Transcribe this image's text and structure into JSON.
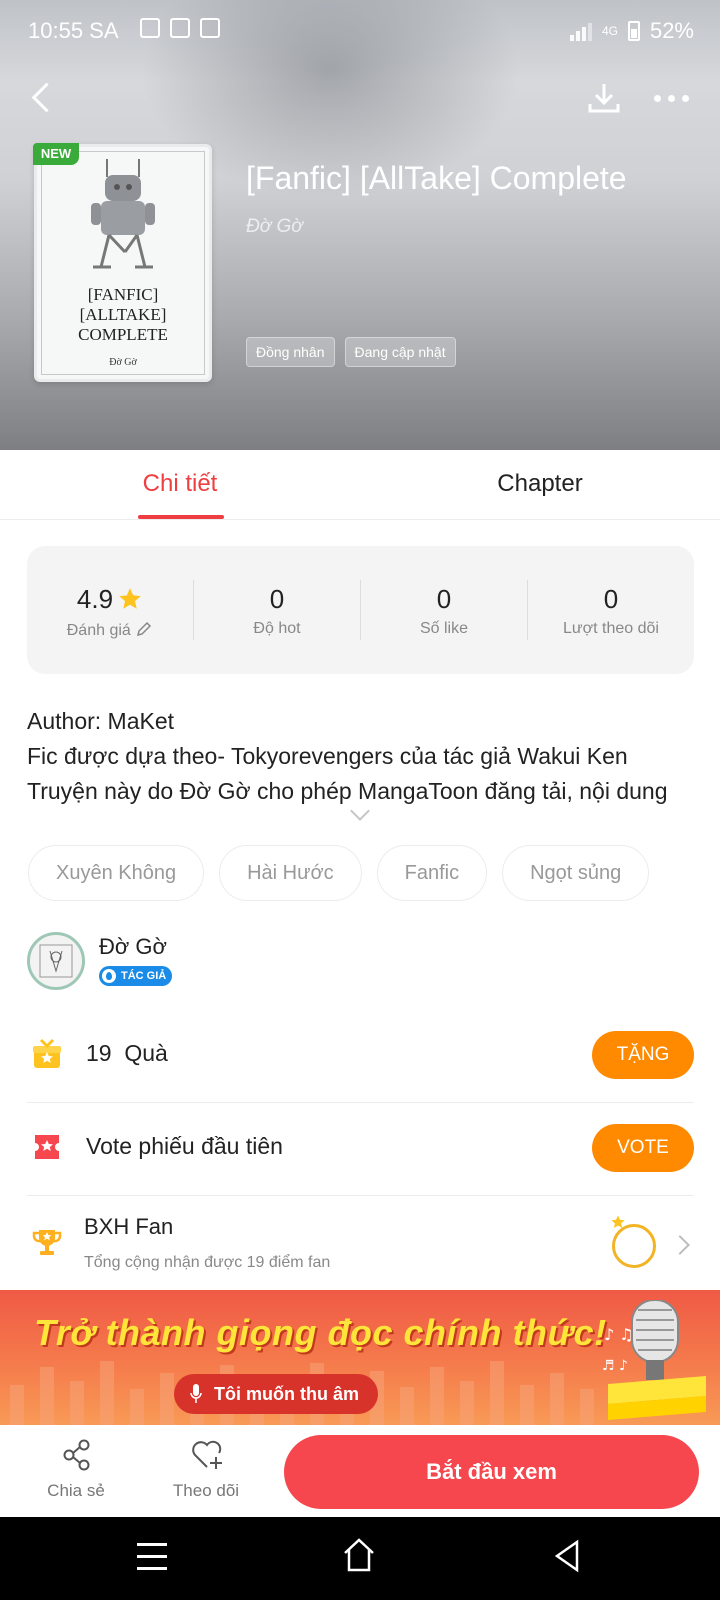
{
  "status_bar": {
    "time": "10:55 SA",
    "network": "4G",
    "battery": "52%"
  },
  "book": {
    "title": "[Fanfic] [AllTake] Complete",
    "author": "Đờ Gờ",
    "badge": "NEW",
    "cover_title": "[FANFIC]\n[ALLTAKE]\nCOMPLETE",
    "cover_author": "Đờ Gờ",
    "tags": [
      "Đồng nhân",
      "Đang cập nhật"
    ]
  },
  "tabs": [
    {
      "label": "Chi tiết",
      "active": true
    },
    {
      "label": "Chapter",
      "active": false
    }
  ],
  "stats": [
    {
      "value": "4.9",
      "label": "Đánh giá",
      "icon": "star-icon"
    },
    {
      "value": "0",
      "label": "Độ hot"
    },
    {
      "value": "0",
      "label": "Số like"
    },
    {
      "value": "0",
      "label": "Lượt theo dõi"
    }
  ],
  "description": {
    "lines": [
      "Author: MaKet",
      " Fic được dựa theo- Tokyorevengers của tác giả Wakui Ken",
      "Truyện này do Đờ Gờ cho phép MangaToon đăng tải, nội dung"
    ]
  },
  "genres": [
    "Xuyên Không",
    "Hài Hước",
    "Fanfic",
    "Ngọt sủng"
  ],
  "author_row": {
    "name": "Đờ Gờ",
    "badge": "TÁC GIẢ"
  },
  "gift_row": {
    "count": "19",
    "label": "Quà",
    "button": "TẶNG"
  },
  "vote_row": {
    "label": "Vote phiếu đầu tiên",
    "button": "VOTE"
  },
  "fan_row": {
    "title": "BXH Fan",
    "subtitle": "Tổng cộng nhận được 19 điểm fan"
  },
  "banner": {
    "title": "Trở thành giọng đọc chính thức!",
    "button": "Tôi muốn thu âm"
  },
  "bottom_bar": {
    "share": "Chia sẻ",
    "follow": "Theo dõi",
    "start": "Bắt đầu xem"
  },
  "colors": {
    "accent": "#ef3e40",
    "orange": "#ff8a00",
    "start_button": "#f5474d",
    "new_badge": "#3aaa3a"
  }
}
